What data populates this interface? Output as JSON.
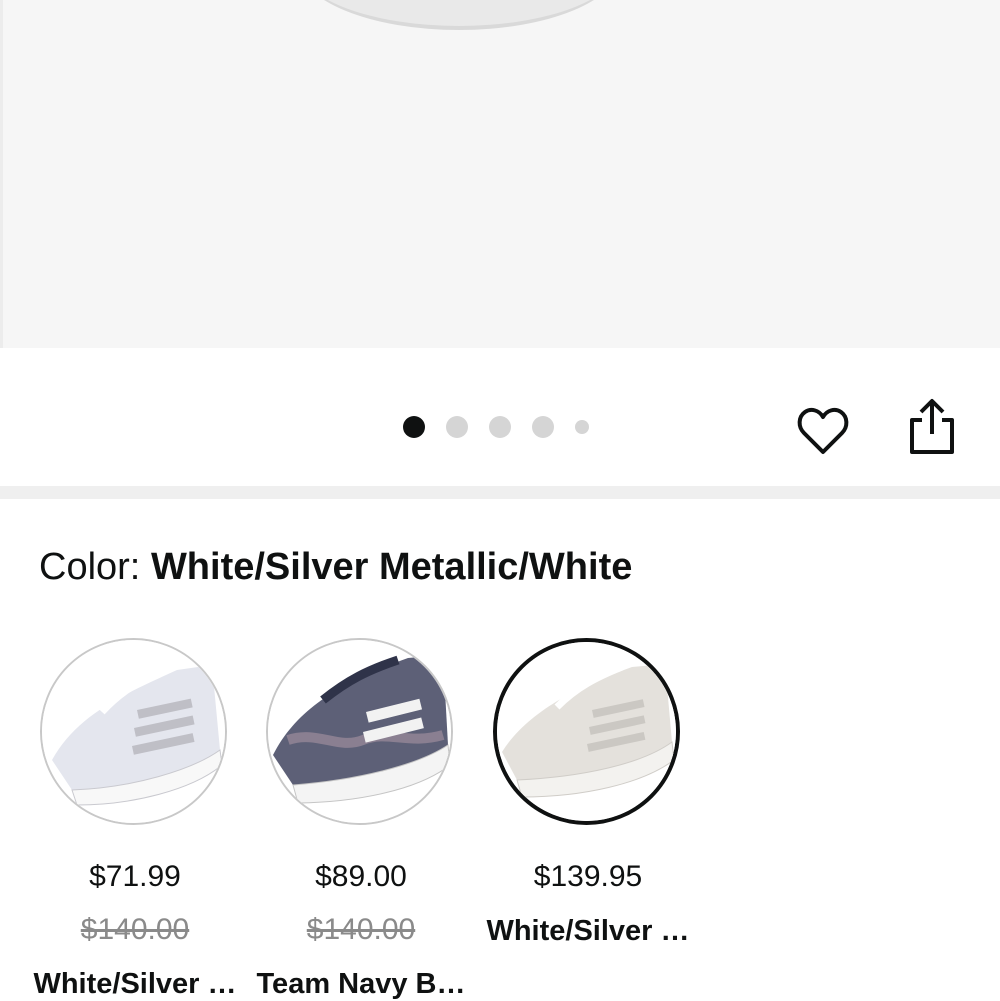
{
  "gallery": {
    "dots": [
      "active",
      "inactive",
      "inactive",
      "inactive",
      "small"
    ],
    "active_color": "#0f1111",
    "inactive_color": "#d5d5d5"
  },
  "actions": {
    "favorite_icon": "heart-outline-icon",
    "share_icon": "share-icon"
  },
  "color_selector": {
    "label": "Color:",
    "selected_value": "White/Silver Metallic/White",
    "swatches": [
      {
        "price": "$71.99",
        "was_price": "$140.00",
        "name": "White/Silver …",
        "selected": false
      },
      {
        "price": "$89.00",
        "was_price": "$140.00",
        "name": "Team Navy B…",
        "selected": false
      },
      {
        "price": "$139.95",
        "name": "White/Silver …",
        "selected": true
      }
    ]
  }
}
